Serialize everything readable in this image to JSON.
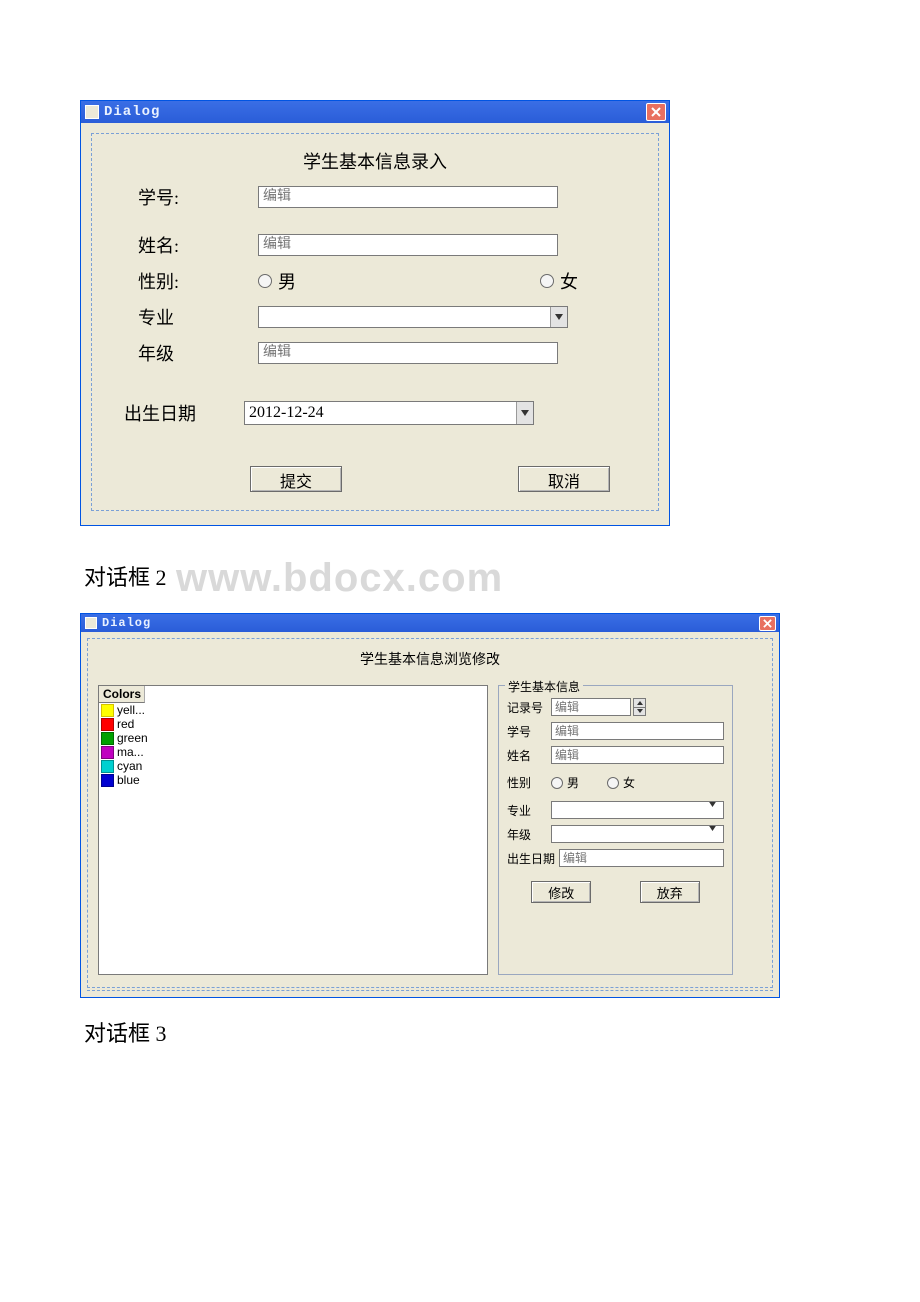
{
  "dialog1": {
    "title": "Dialog",
    "group_title": "学生基本信息录入",
    "labels": {
      "student_id": "学号:",
      "name": "姓名:",
      "gender": "性别:",
      "major": "专业",
      "grade": "年级",
      "birth": "出生日期"
    },
    "fields": {
      "student_id_placeholder": "编辑",
      "name_placeholder": "编辑",
      "gender_male": "男",
      "gender_female": "女",
      "major_value": "",
      "grade_placeholder": "编辑",
      "birth_value": "2012-12-24"
    },
    "buttons": {
      "submit": "提交",
      "cancel": "取消"
    }
  },
  "caption2_prefix": "对话框 2",
  "watermark": "www.bdocx.com",
  "dialog2": {
    "title": "Dialog",
    "group_title": "学生基本信息浏览修改",
    "list_header": "Colors",
    "list_items": [
      {
        "color_name": "yell...",
        "swatch": "sw-yellow"
      },
      {
        "color_name": "red",
        "swatch": "sw-red"
      },
      {
        "color_name": "green",
        "swatch": "sw-green"
      },
      {
        "color_name": "ma...",
        "swatch": "sw-magenta"
      },
      {
        "color_name": "cyan",
        "swatch": "sw-cyan"
      },
      {
        "color_name": "blue",
        "swatch": "sw-blue"
      }
    ],
    "fieldset_title": "学生基本信息",
    "labels": {
      "record_no": "记录号",
      "student_id": "学号",
      "name": "姓名",
      "gender": "性别",
      "gender_male": "男",
      "gender_female": "女",
      "major": "专业",
      "grade": "年级",
      "birth": "出生日期"
    },
    "fields": {
      "record_no_placeholder": "编辑",
      "student_id_placeholder": "编辑",
      "name_placeholder": "编辑",
      "birth_placeholder": "编辑"
    },
    "buttons": {
      "modify": "修改",
      "discard": "放弃"
    }
  },
  "caption3": "对话框 3"
}
